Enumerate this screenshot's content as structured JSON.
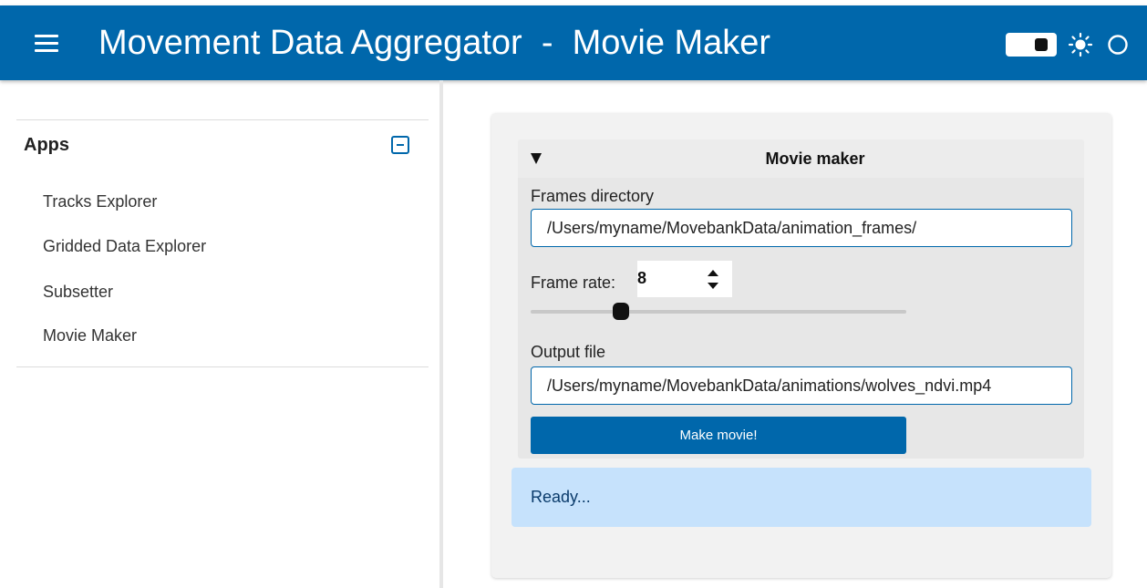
{
  "header": {
    "title": "Movement Data Aggregator  -  Movie Maker",
    "menu_icon": "hamburger-menu-icon",
    "theme_toggle_icon": "toggle-switch-icon",
    "light_icon": "sun-icon",
    "dark_icon": "circle-icon",
    "background_color": "#0067ab"
  },
  "sidebar": {
    "title": "Apps",
    "collapse_icon": "minus-square-icon",
    "items": [
      {
        "label": "Tracks Explorer"
      },
      {
        "label": "Gridded Data Explorer"
      },
      {
        "label": "Subsetter"
      },
      {
        "label": "Movie Maker"
      }
    ]
  },
  "main": {
    "accordion": {
      "title": "Movie maker",
      "toggle_icon": "triangle-down-icon"
    },
    "frames_directory": {
      "label": "Frames directory",
      "value": "/Users/myname/MovebankData/animation_frames/"
    },
    "frame_rate": {
      "label": "Frame rate:",
      "value": "8",
      "slider_fraction": 0.24
    },
    "output_file": {
      "label": "Output file",
      "value": "/Users/myname/MovebankData/animations/wolves_ndvi.mp4"
    },
    "make_button": "Make movie!",
    "status": "Ready...",
    "status_color": "#c6e2fc"
  }
}
